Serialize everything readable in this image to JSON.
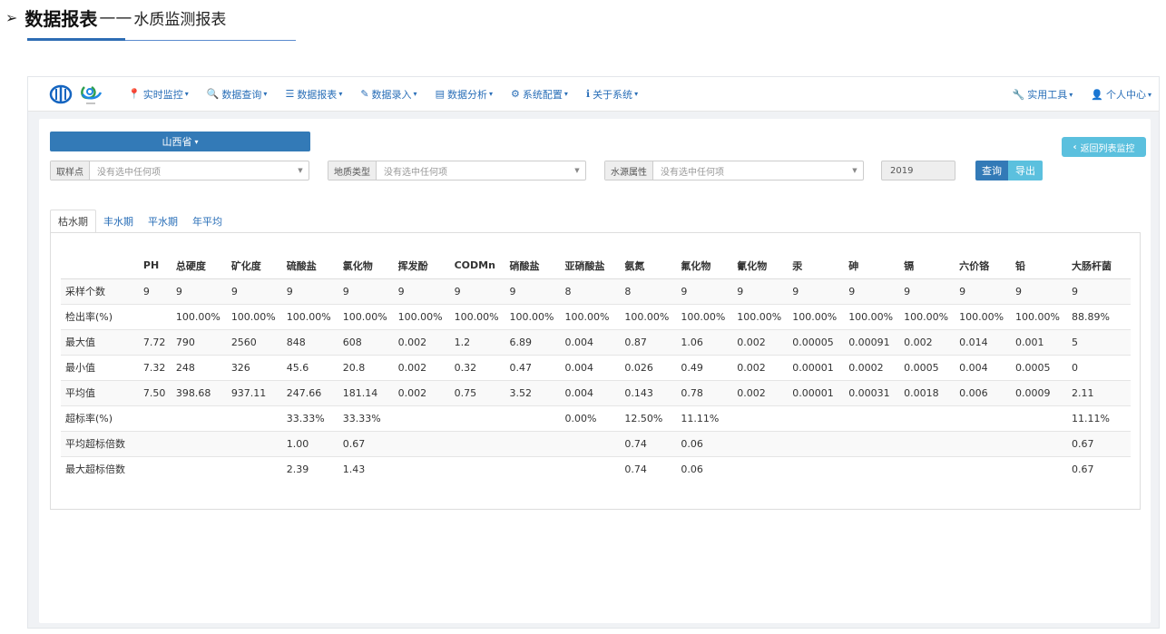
{
  "heading": {
    "arrow": "➢",
    "bold": "数据报表",
    "dash": "——",
    "subtitle": "水质监测报表"
  },
  "navbar": {
    "logo": "water-quality-logo",
    "items": [
      {
        "icon": "map-marker-icon",
        "glyph": "📍",
        "label": "实时监控"
      },
      {
        "icon": "search-icon",
        "glyph": "🔍",
        "label": "数据查询"
      },
      {
        "icon": "list-icon",
        "glyph": "☰",
        "label": "数据报表"
      },
      {
        "icon": "edit-icon",
        "glyph": "✎",
        "label": "数据录入"
      },
      {
        "icon": "tasks-icon",
        "glyph": "▤",
        "label": "数据分析"
      },
      {
        "icon": "cog-icon",
        "glyph": "⚙",
        "label": "系统配置"
      },
      {
        "icon": "info-icon",
        "glyph": "ℹ",
        "label": "关于系统"
      }
    ],
    "right_items": [
      {
        "icon": "wrench-icon",
        "glyph": "🔧",
        "label": "实用工具"
      },
      {
        "icon": "user-icon",
        "glyph": "👤",
        "label": "个人中心"
      }
    ]
  },
  "province": "山西省",
  "back_button": "返回列表监控",
  "filters": [
    {
      "label": "取样点",
      "placeholder": "没有选中任何项"
    },
    {
      "label": "地质类型",
      "placeholder": "没有选中任何项"
    },
    {
      "label": "水源属性",
      "placeholder": "没有选中任何项"
    }
  ],
  "year": "2019",
  "query_button": "查询",
  "export_button": "导出",
  "tabs": [
    "枯水期",
    "丰水期",
    "平水期",
    "年平均"
  ],
  "active_tab": 0,
  "table": {
    "columns": [
      "",
      "PH",
      "总硬度",
      "矿化度",
      "硫酸盐",
      "氯化物",
      "挥发酚",
      "CODMn",
      "硝酸盐",
      "亚硝酸盐",
      "氨氮",
      "氟化物",
      "氰化物",
      "汞",
      "砷",
      "镉",
      "六价铬",
      "铅",
      "大肠杆菌"
    ],
    "rows": [
      [
        "采样个数",
        "9",
        "9",
        "9",
        "9",
        "9",
        "9",
        "9",
        "9",
        "8",
        "8",
        "9",
        "9",
        "9",
        "9",
        "9",
        "9",
        "9",
        "9"
      ],
      [
        "检出率(%)",
        "",
        "100.00%",
        "100.00%",
        "100.00%",
        "100.00%",
        "100.00%",
        "100.00%",
        "100.00%",
        "100.00%",
        "100.00%",
        "100.00%",
        "100.00%",
        "100.00%",
        "100.00%",
        "100.00%",
        "100.00%",
        "100.00%",
        "88.89%"
      ],
      [
        "最大值",
        "7.72",
        "790",
        "2560",
        "848",
        "608",
        "0.002",
        "1.2",
        "6.89",
        "0.004",
        "0.87",
        "1.06",
        "0.002",
        "0.00005",
        "0.00091",
        "0.002",
        "0.014",
        "0.001",
        "5"
      ],
      [
        "最小值",
        "7.32",
        "248",
        "326",
        "45.6",
        "20.8",
        "0.002",
        "0.32",
        "0.47",
        "0.004",
        "0.026",
        "0.49",
        "0.002",
        "0.00001",
        "0.0002",
        "0.0005",
        "0.004",
        "0.0005",
        "0"
      ],
      [
        "平均值",
        "7.50",
        "398.68",
        "937.11",
        "247.66",
        "181.14",
        "0.002",
        "0.75",
        "3.52",
        "0.004",
        "0.143",
        "0.78",
        "0.002",
        "0.00001",
        "0.00031",
        "0.0018",
        "0.006",
        "0.0009",
        "2.11"
      ],
      [
        "超标率(%)",
        "",
        "",
        "",
        "33.33%",
        "33.33%",
        "",
        "",
        "",
        "0.00%",
        "12.50%",
        "11.11%",
        "",
        "",
        "",
        "",
        "",
        "",
        "11.11%"
      ],
      [
        "平均超标倍数",
        "",
        "",
        "",
        "1.00",
        "0.67",
        "",
        "",
        "",
        "",
        "0.74",
        "0.06",
        "",
        "",
        "",
        "",
        "",
        "",
        "0.67"
      ],
      [
        "最大超标倍数",
        "",
        "",
        "",
        "2.39",
        "1.43",
        "",
        "",
        "",
        "",
        "0.74",
        "0.06",
        "",
        "",
        "",
        "",
        "",
        "",
        "0.67"
      ]
    ]
  }
}
